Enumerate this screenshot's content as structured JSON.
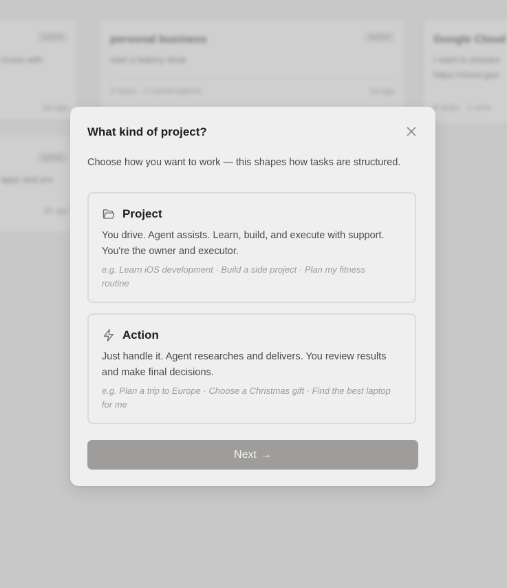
{
  "background": {
    "cards": [
      {
        "title": "",
        "description": "ncase with",
        "badge": "active",
        "meta_left": "",
        "meta_right": "2d ago"
      },
      {
        "title": "personal business",
        "description": "start a bakery shop",
        "badge": "active",
        "meta_left": "3 tasks · 2 conversations",
        "meta_right": "1d ago"
      },
      {
        "title": "Google Cloud",
        "description": "I want to prepare",
        "description2": "https://cloud.goo",
        "badge": "",
        "meta_left": "4 tasks · 1 conv",
        "meta_right": ""
      },
      {
        "title": "",
        "description": "apps and pro",
        "badge": "active",
        "meta_left": "",
        "meta_right": "5h ago"
      }
    ]
  },
  "modal": {
    "title": "What kind of project?",
    "subtitle": "Choose how you want to work — this shapes how tasks are structured.",
    "close_icon": "close-icon",
    "options": [
      {
        "icon": "folder-icon",
        "title": "Project",
        "description": "You drive. Agent assists. Learn, build, and execute with support. You're the owner and executor.",
        "examples": "e.g. Learn iOS development · Build a side project · Plan my fitness routine"
      },
      {
        "icon": "lightning-icon",
        "title": "Action",
        "description": "Just handle it. Agent researches and delivers. You review results and make final decisions.",
        "examples": "e.g. Plan a trip to Europe · Choose a Christmas gift · Find the best laptop for me"
      }
    ],
    "next_label": "Next",
    "next_arrow": "→"
  },
  "colors": {
    "overlay": "#c8c8c8",
    "modal_bg": "#efefef",
    "button_disabled": "#9e9d9b",
    "title_text": "#1e1e1e"
  }
}
